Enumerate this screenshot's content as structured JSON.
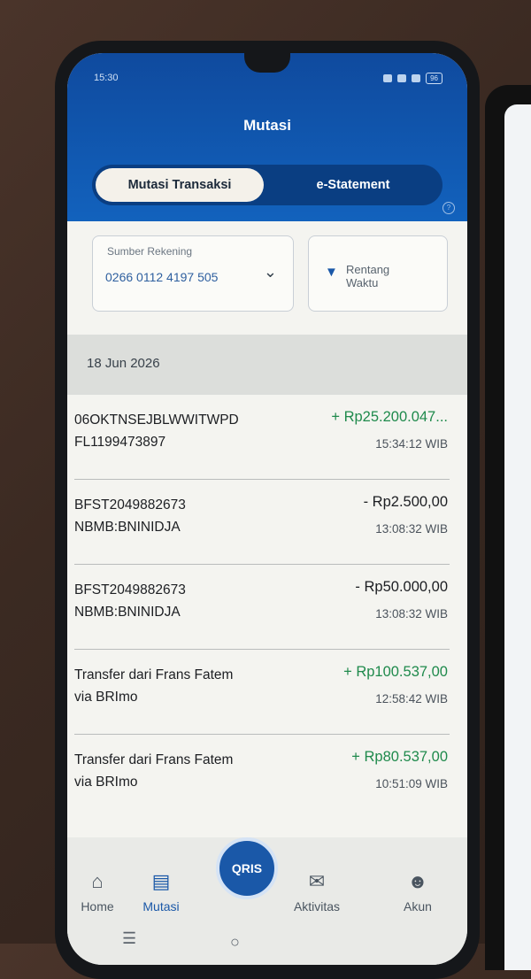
{
  "status_bar": {
    "time": "15:30",
    "battery": "96"
  },
  "header": {
    "title": "Mutasi"
  },
  "tabs": [
    {
      "label": "Mutasi Transaksi",
      "active": true
    },
    {
      "label": "e-Statement",
      "active": false
    }
  ],
  "filters": {
    "source_label": "Sumber Rekening",
    "source_value": "0266 0112 4197 505",
    "range_label": "Rentang Waktu"
  },
  "date_header": "18 Jun 2026",
  "transactions": [
    {
      "line1": "06OKTNSEJBLWWITWPD",
      "line2": "FL1199473897",
      "amount": "+ Rp25.200.047...",
      "time": "15:34:12 WIB",
      "type": "credit"
    },
    {
      "line1": "BFST2049882673",
      "line2": "NBMB:BNINIDJA",
      "amount": "- Rp2.500,00",
      "time": "13:08:32 WIB",
      "type": "debit"
    },
    {
      "line1": "BFST2049882673",
      "line2": "NBMB:BNINIDJA",
      "amount": "- Rp50.000,00",
      "time": "13:08:32 WIB",
      "type": "debit"
    },
    {
      "line1": "Transfer dari Frans Fatem",
      "line2": "via BRImo",
      "amount": "+ Rp100.537,00",
      "time": "12:58:42 WIB",
      "type": "credit"
    },
    {
      "line1": "Transfer dari Frans Fatem",
      "line2": "via BRImo",
      "amount": "+ Rp80.537,00",
      "time": "10:51:09 WIB",
      "type": "credit"
    }
  ],
  "bottom_nav": {
    "home": "Home",
    "mutasi": "Mutasi",
    "qris": "QRIS",
    "aktivitas": "Aktivitas",
    "akun": "Akun"
  },
  "colors": {
    "header_blue": "#1262bd",
    "credit_green": "#1f8a4c",
    "accent_blue": "#1a58a8"
  }
}
